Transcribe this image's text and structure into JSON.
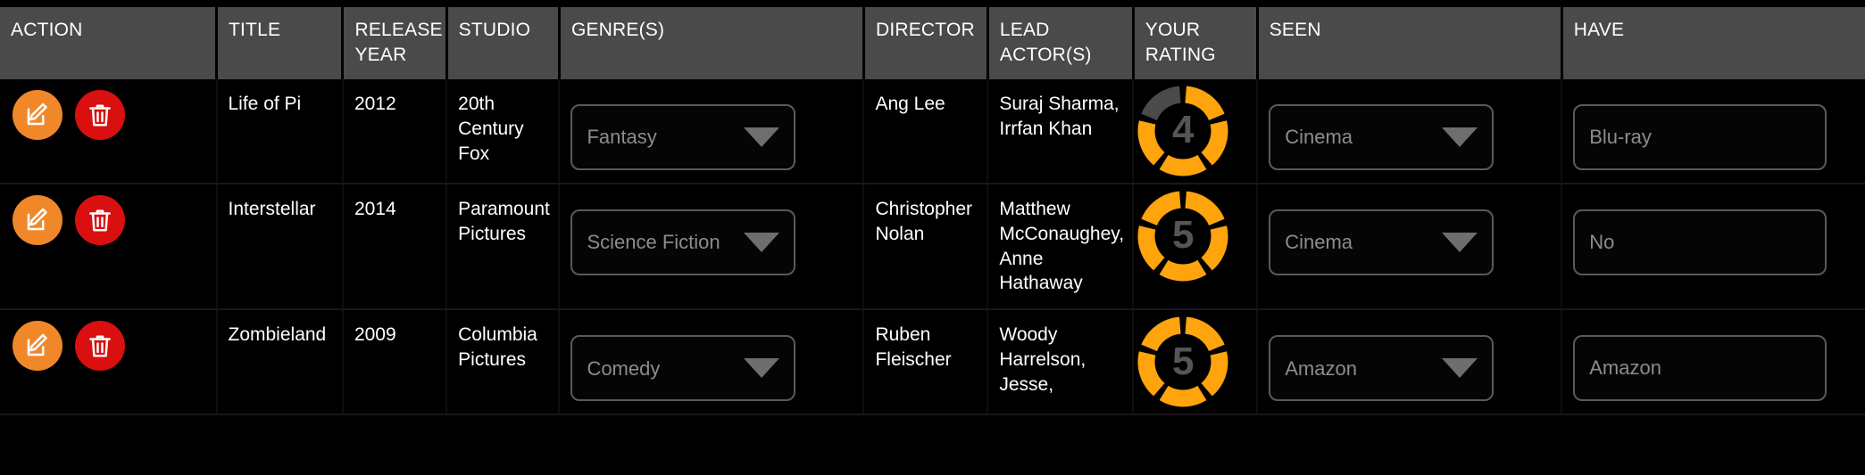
{
  "table": {
    "columns": [
      {
        "key": "action",
        "label": "ACTION"
      },
      {
        "key": "title",
        "label": "TITLE"
      },
      {
        "key": "year",
        "label": "RELEASE YEAR"
      },
      {
        "key": "studio",
        "label": "STUDIO"
      },
      {
        "key": "genre",
        "label": "GENRE(S)"
      },
      {
        "key": "director",
        "label": "DIRECTOR"
      },
      {
        "key": "actors",
        "label": "LEAD ACTOR(S)"
      },
      {
        "key": "rating",
        "label": "YOUR RATING"
      },
      {
        "key": "seen",
        "label": "SEEN"
      },
      {
        "key": "have",
        "label": "HAVE"
      }
    ],
    "headers": {
      "action": "ACTION",
      "title": "TITLE",
      "year": "RELEASE YEAR",
      "studio": "STUDIO",
      "genre": "GENRE(S)",
      "director": "DIRECTOR",
      "actors": "LEAD ACTOR(S)",
      "rating": "YOUR RATING",
      "seen": "SEEN",
      "have": "HAVE"
    },
    "rows": [
      {
        "title": "Life of Pi",
        "year": "2012",
        "studio": "20th Century Fox",
        "genre": "Fantasy",
        "director": "Ang Lee",
        "actors": "Suraj Sharma, Irrfan Khan",
        "rating": "4",
        "rating_max": 5,
        "seen": "Cinema",
        "have": "Blu-ray",
        "edit_label": "Edit",
        "delete_label": "Delete"
      },
      {
        "title": "Interstellar",
        "year": "2014",
        "studio": "Paramount Pictures",
        "genre": "Science Fiction",
        "director": "Christopher Nolan",
        "actors": "Matthew McConaughey, Anne Hathaway",
        "rating": "5",
        "rating_max": 5,
        "seen": "Cinema",
        "have": "No",
        "edit_label": "Edit",
        "delete_label": "Delete"
      },
      {
        "title": "Zombieland",
        "year": "2009",
        "studio": "Columbia Pictures",
        "genre": "Comedy",
        "director": "Ruben Fleischer",
        "actors": "Woody Harrelson, Jesse,",
        "rating": "5",
        "rating_max": 5,
        "seen": "Amazon",
        "have": "Amazon",
        "edit_label": "Edit",
        "delete_label": "Delete"
      }
    ]
  },
  "icons": {
    "edit": "edit-pencil-icon",
    "delete": "trash-icon",
    "caret": "chevron-down-icon"
  },
  "colors": {
    "header_bg": "#4a4a4a",
    "row_bg": "#000000",
    "edit_button": "#f0882a",
    "delete_button": "#da0f0f",
    "rating_filled": "#FFA40C",
    "rating_empty": "#4a4a4a",
    "rating_number": "#555555",
    "placeholder_text": "#8c8c8c",
    "field_border": "#5a5a5a"
  }
}
